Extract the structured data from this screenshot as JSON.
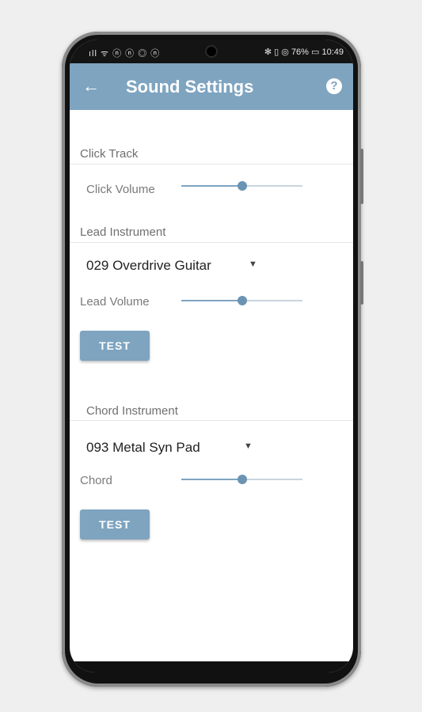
{
  "status_bar": {
    "left_icons": "ıll ᯤ ⓝ ⓝ ◎ ⓝ",
    "right_text": "✻ ▯ ◎ 76% ▭ 10:49"
  },
  "app_bar": {
    "back_icon": "←",
    "title": "Sound Settings",
    "help_icon": "?"
  },
  "click_track": {
    "header": "Click Track",
    "volume_label": "Click Volume",
    "volume_level": 0.5
  },
  "lead": {
    "header": "Lead Instrument",
    "instrument": "029 Overdrive Guitar",
    "volume_label": "Lead Volume",
    "volume_level": 0.5,
    "test_label": "TEST"
  },
  "chord": {
    "header": "Chord Instrument",
    "instrument": "093 Metal Syn Pad",
    "volume_label": "Chord",
    "volume_level": 0.5,
    "test_label": "TEST"
  },
  "colors": {
    "accent": "#7ea4c0",
    "background": "#efefef"
  }
}
